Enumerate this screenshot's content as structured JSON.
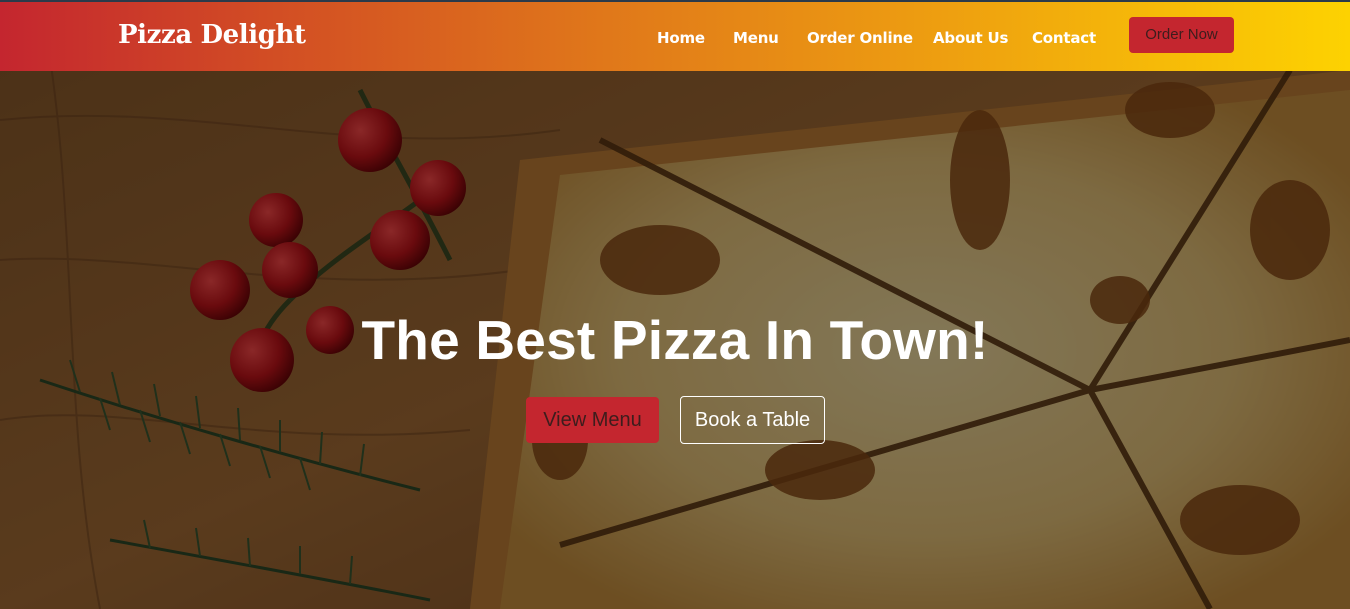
{
  "header": {
    "brand": "Pizza Delight",
    "nav": {
      "home": "Home",
      "menu": "Menu",
      "order_online": "Order Online",
      "about": "About Us",
      "contact": "Contact"
    },
    "cta_label": "Order Now"
  },
  "hero": {
    "title": "The Best Pizza In Town!",
    "primary_button": "View Menu",
    "secondary_button": "Book a Table"
  },
  "colors": {
    "brand_red": "#c4262f",
    "gradient_end": "#fdd201",
    "text_light": "#ffffff"
  },
  "icons": {
    "hero_image": "pizza-on-wooden-board-image"
  }
}
